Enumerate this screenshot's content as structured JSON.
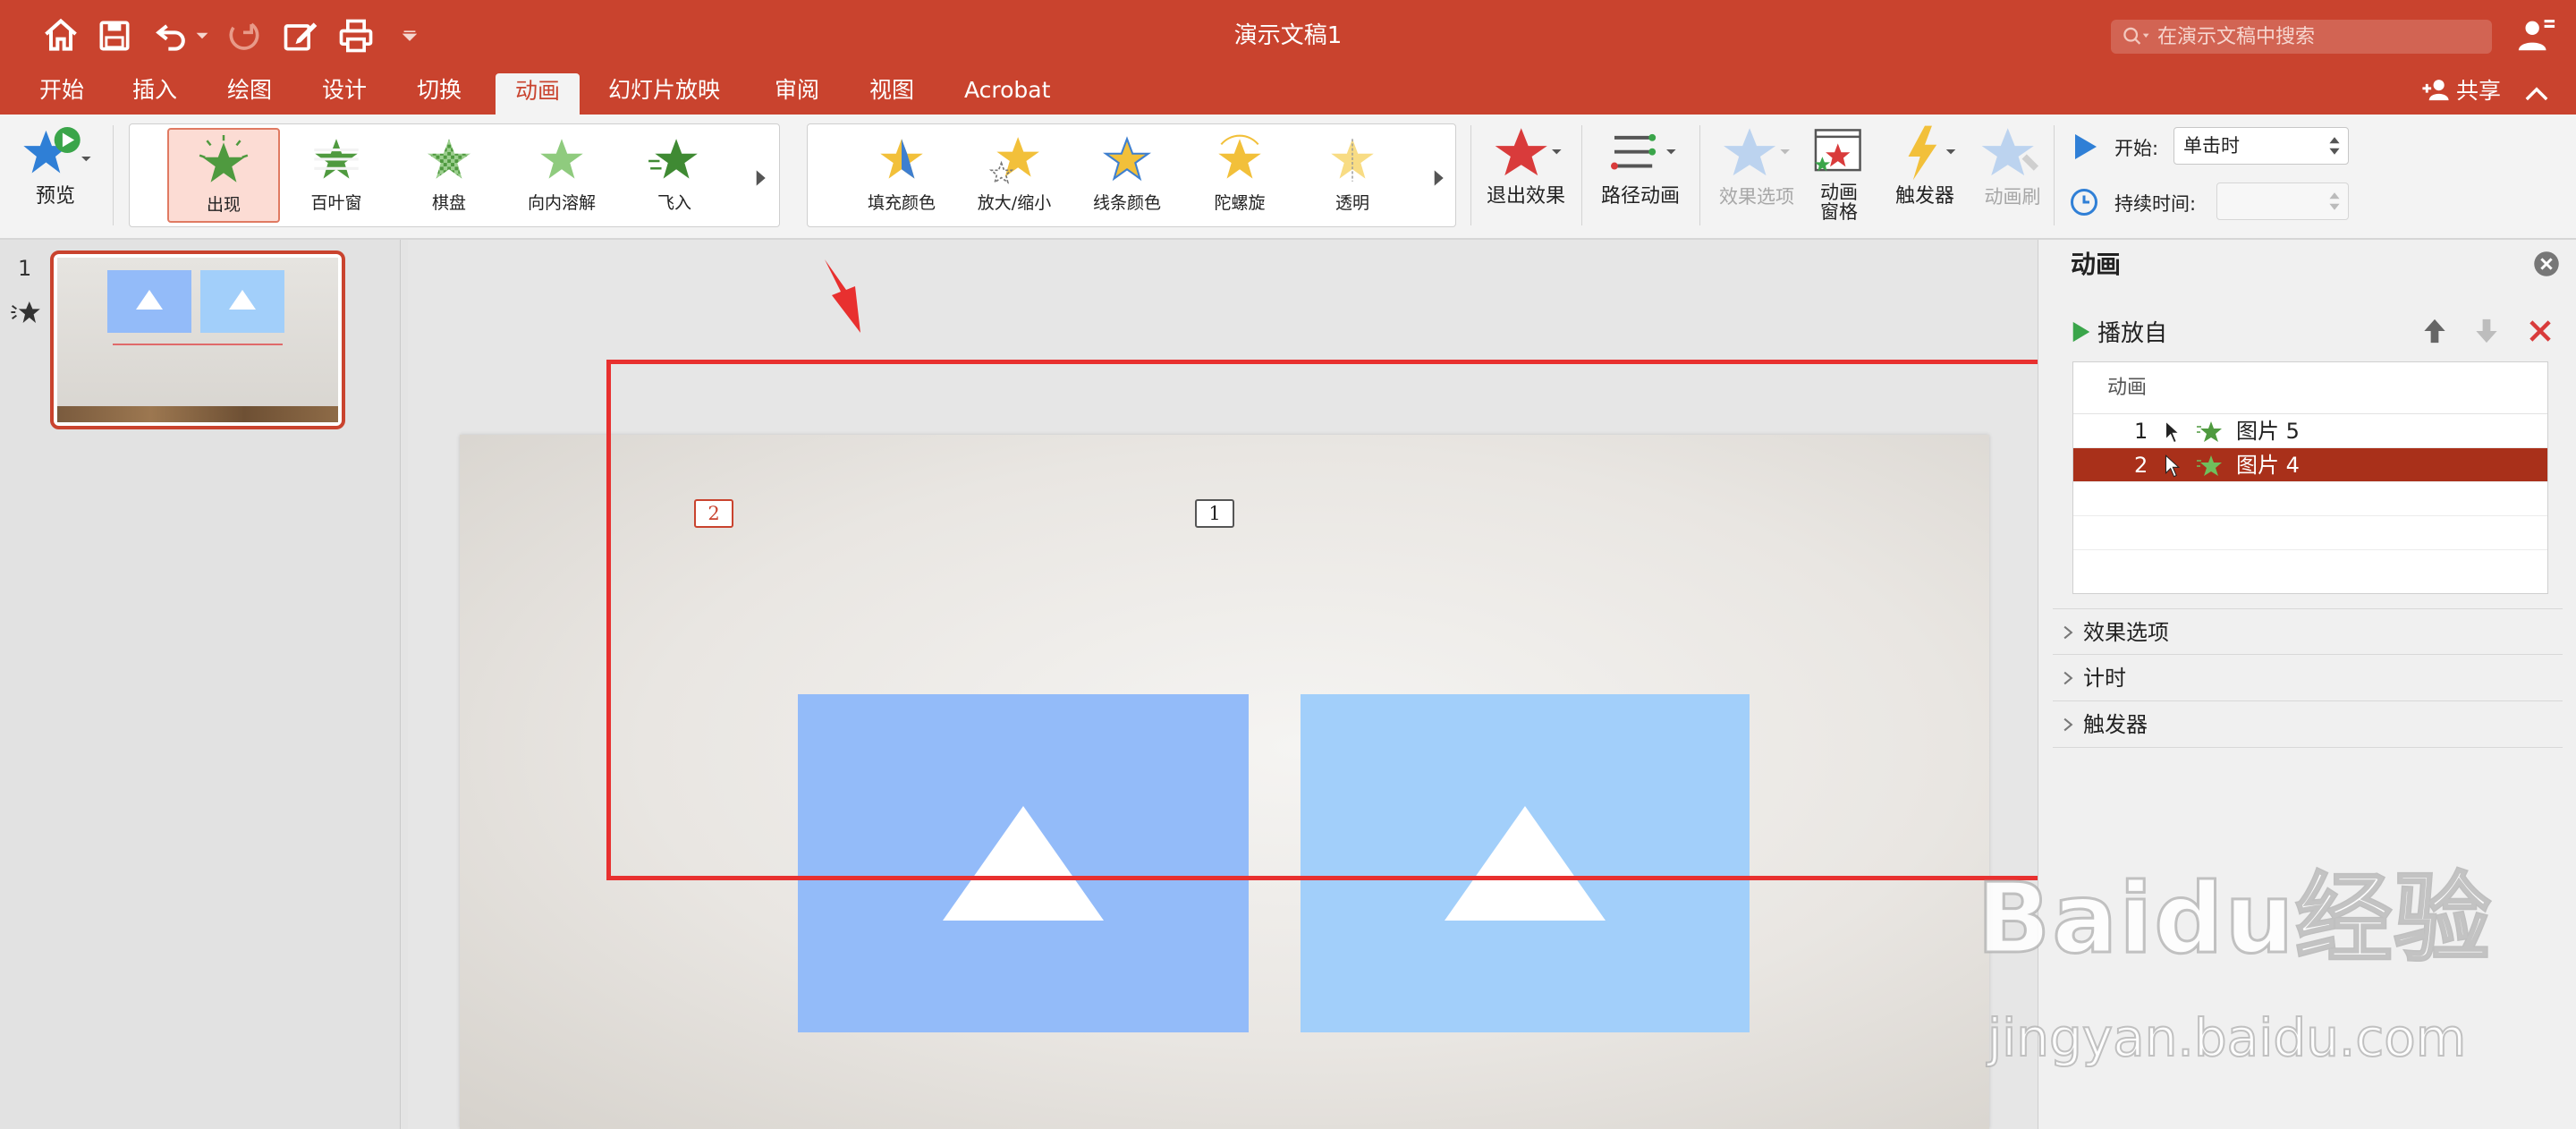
{
  "window": {
    "title": "演示文稿1",
    "search_placeholder": "在演示文稿中搜索"
  },
  "menu": {
    "tabs": [
      "开始",
      "插入",
      "绘图",
      "设计",
      "切换",
      "动画",
      "幻灯片放映",
      "审阅",
      "视图",
      "Acrobat"
    ],
    "active_tab": "动画",
    "share_label": "共享"
  },
  "ribbon": {
    "preview_label": "预览",
    "entrance_effects": [
      "出现",
      "百叶窗",
      "棋盘",
      "向内溶解",
      "飞入"
    ],
    "selected_entrance": "出现",
    "emphasis_effects": [
      "填充颜色",
      "放大/缩小",
      "线条颜色",
      "陀螺旋",
      "透明"
    ],
    "exit_label": "退出效果",
    "path_label": "路径动画",
    "effect_options_label": "效果选项",
    "animation_pane_label_line1": "动画",
    "animation_pane_label_line2": "窗格",
    "trigger_label": "触发器",
    "painter_label": "动画刷",
    "start_label": "开始:",
    "start_value": "单击时",
    "duration_label": "持续时间:"
  },
  "thumbnails": {
    "slide_number": "1"
  },
  "slide": {
    "tags": [
      "2",
      "1"
    ]
  },
  "anim_pane": {
    "title": "动画",
    "play_from_label": "播放自",
    "list_header": "动画",
    "items": [
      {
        "number": "1",
        "name": "图片 5",
        "selected": false
      },
      {
        "number": "2",
        "name": "图片 4",
        "selected": true
      }
    ],
    "sections": [
      "效果选项",
      "计时",
      "触发器"
    ]
  },
  "watermark": {
    "brand": "Baidu经验",
    "url": "jingyan.baidu.com"
  },
  "colors": {
    "accent": "#c9432e",
    "selected_row": "#a9301a",
    "highlight_box": "#e8302f",
    "picture_left": "#93bbf9",
    "picture_right": "#a2cffa"
  }
}
